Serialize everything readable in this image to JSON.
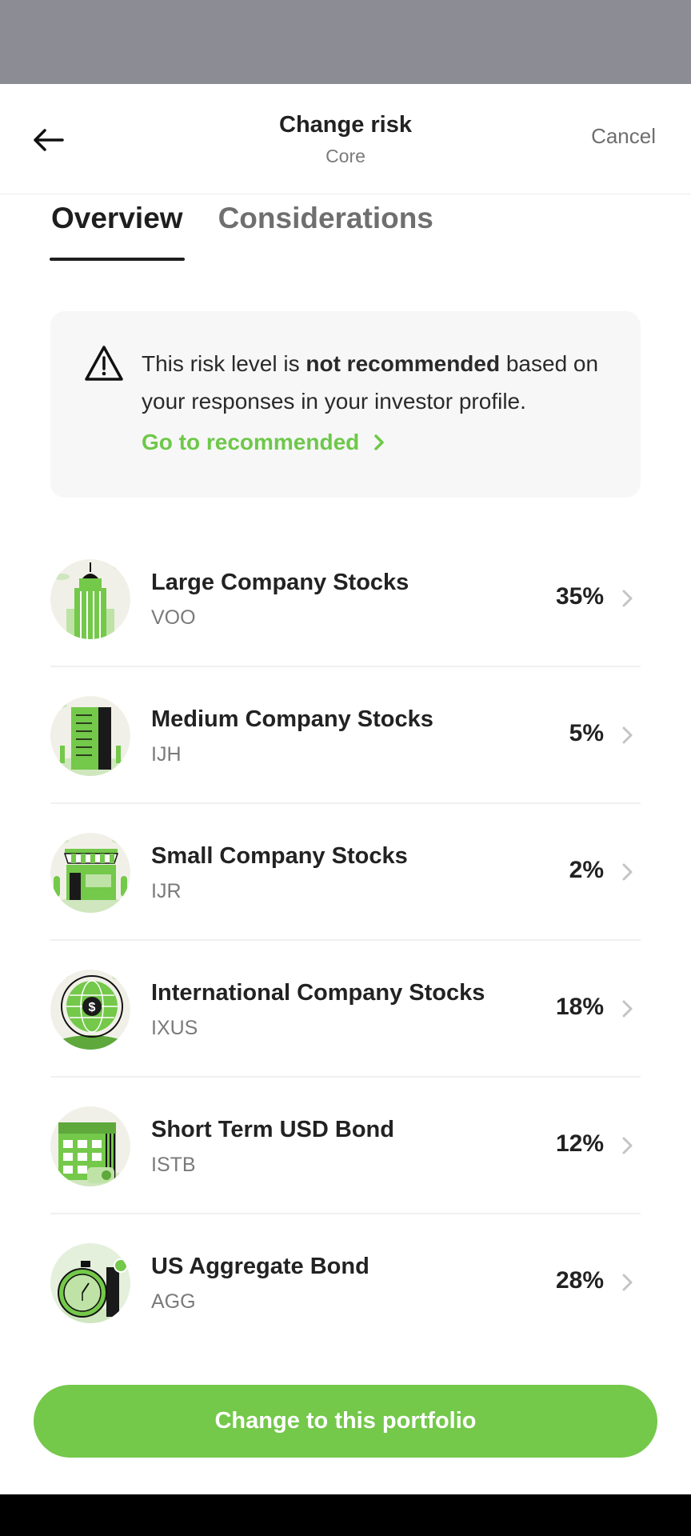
{
  "header": {
    "title": "Change risk",
    "subtitle": "Core",
    "cancel_label": "Cancel"
  },
  "tabs": [
    {
      "label": "Overview",
      "active": true
    },
    {
      "label": "Considerations",
      "active": false
    }
  ],
  "notice": {
    "text_before": "This risk level is ",
    "text_bold": "not recommended",
    "text_after": " based on your responses in your investor profile.",
    "link_label": "Go to recommended"
  },
  "holdings": [
    {
      "name": "Large Company Stocks",
      "ticker": "VOO",
      "percent": "35%",
      "icon": "skyscraper-icon"
    },
    {
      "name": "Medium Company Stocks",
      "ticker": "IJH",
      "percent": "5%",
      "icon": "office-building-icon"
    },
    {
      "name": "Small Company Stocks",
      "ticker": "IJR",
      "percent": "2%",
      "icon": "storefront-icon"
    },
    {
      "name": "International Company Stocks",
      "ticker": "IXUS",
      "percent": "18%",
      "icon": "globe-dollar-icon"
    },
    {
      "name": "Short Term USD Bond",
      "ticker": "ISTB",
      "percent": "12%",
      "icon": "calendar-icon"
    },
    {
      "name": "US Aggregate Bond",
      "ticker": "AGG",
      "percent": "28%",
      "icon": "stopwatch-icon"
    }
  ],
  "cta_label": "Change to this portfolio",
  "colors": {
    "accent": "#74c84a",
    "link": "#6ec84a",
    "status_bar": "#8c8c94"
  }
}
